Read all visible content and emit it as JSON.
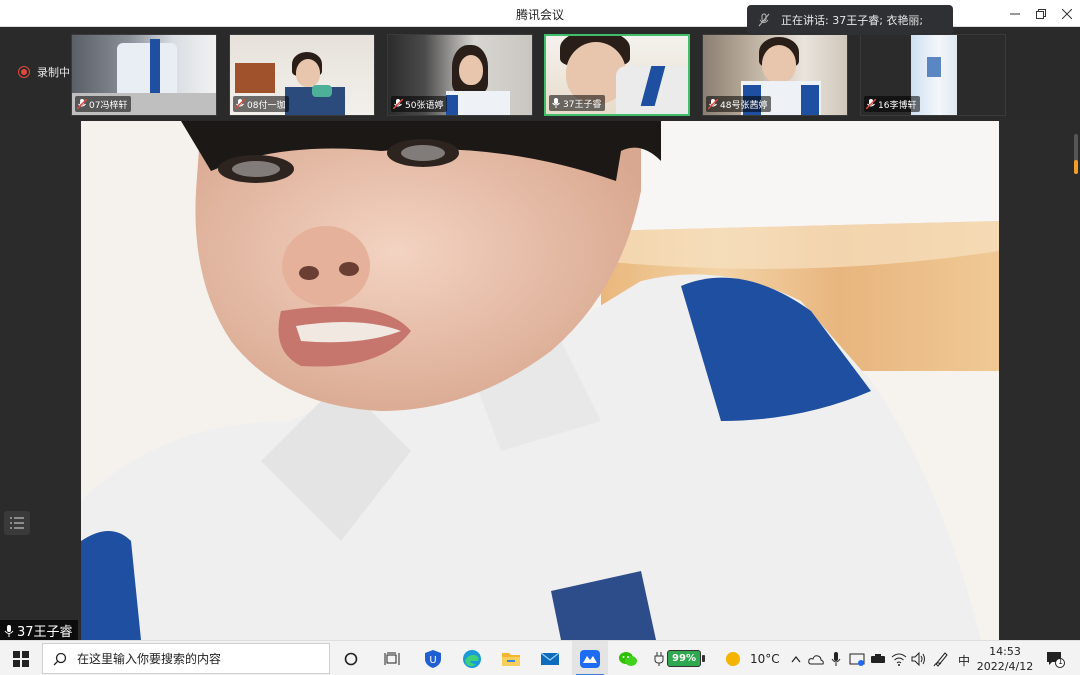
{
  "window": {
    "title": "腾讯会议",
    "speaking_label": "正在讲话: 37王子睿; 衣艳丽;",
    "recording_label": "录制中"
  },
  "participants": [
    {
      "name": "07冯梓轩",
      "mic": "muted"
    },
    {
      "name": "08付一珈",
      "mic": "muted"
    },
    {
      "name": "50张语婷",
      "mic": "muted"
    },
    {
      "name": "37王子睿",
      "mic": "on",
      "active": true
    },
    {
      "name": "48号张茜婷",
      "mic": "muted"
    },
    {
      "name": "16李博轩",
      "mic": "muted"
    }
  ],
  "main_video": {
    "speaker_name": "37王子睿"
  },
  "taskbar": {
    "search_placeholder": "在这里输入你要搜索的内容",
    "battery_percent": "99%",
    "temperature": "10°C",
    "ime": "中",
    "time": "14:53",
    "date": "2022/4/12",
    "notification_count": "1"
  },
  "colors": {
    "active_border": "#3fbf6a",
    "recording": "#e04a3c",
    "battery": "#2fa84f"
  }
}
